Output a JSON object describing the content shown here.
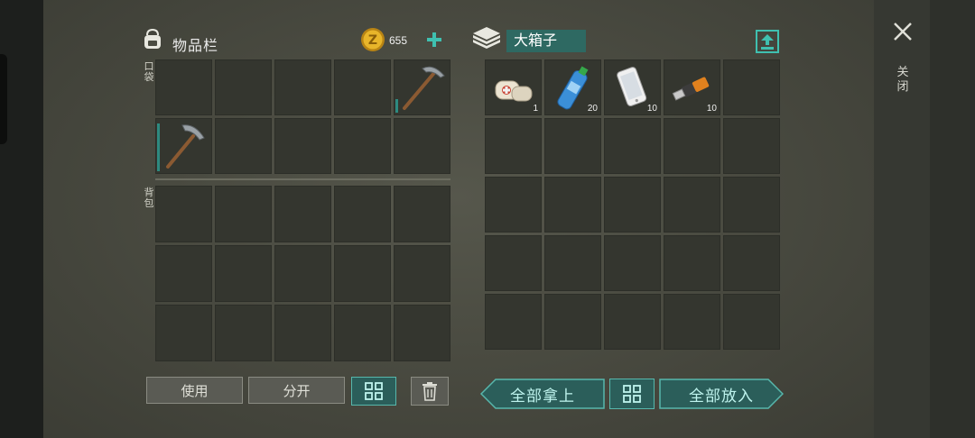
{
  "inventory": {
    "title": "物品栏",
    "coins": "655",
    "pocket_label": "口袋",
    "backpack_label": "背包",
    "pocket_slots": [
      {
        "item": ""
      },
      {
        "item": ""
      },
      {
        "item": ""
      },
      {
        "item": ""
      },
      {
        "item": "pickaxe-icon"
      },
      {
        "item": "pickaxe-icon"
      },
      {
        "item": ""
      },
      {
        "item": ""
      },
      {
        "item": ""
      },
      {
        "item": ""
      }
    ]
  },
  "container": {
    "name": "大箱子",
    "slots": [
      {
        "item": "bandage-icon",
        "count": "1"
      },
      {
        "item": "water-bottle-icon",
        "count": "20"
      },
      {
        "item": "smartphone-icon",
        "count": "10"
      },
      {
        "item": "usb-drive-icon",
        "count": "10"
      },
      {
        "item": "",
        "count": ""
      }
    ]
  },
  "buttons": {
    "use": "使用",
    "split": "分开",
    "take_all": "全部拿上",
    "put_all": "全部放入",
    "close": "关闭"
  },
  "colors": {
    "accent_teal": "#57b7ac",
    "teal_fill": "#2b5e5a",
    "coin_gold": "#d9a520"
  }
}
